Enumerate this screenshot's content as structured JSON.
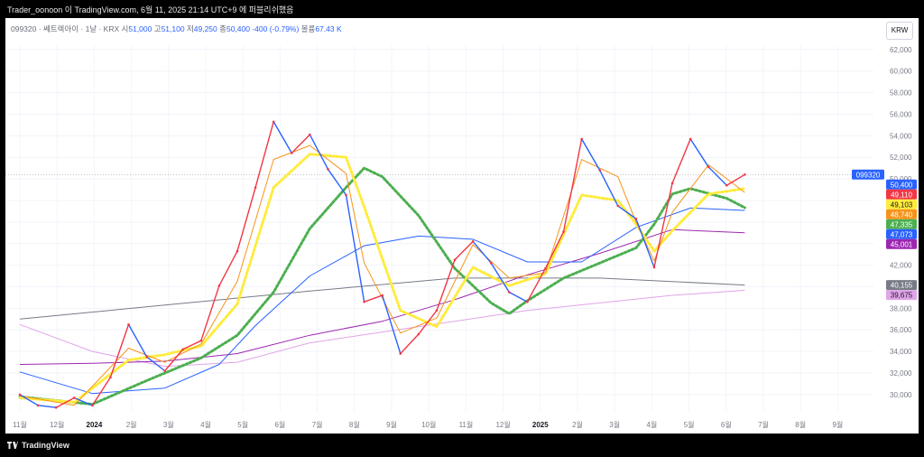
{
  "header": {
    "title": "Trader_oonoon 이 TradingView.com, 6월 11, 2025 21:14 UTC+9 에 퍼블리쉬했음"
  },
  "legend": {
    "symbol": "099320 · 쎄트렉아이 · 1날 · KRX",
    "open_label": "시",
    "open": "51,000",
    "high_label": "고",
    "high": "51,100",
    "low_label": "저",
    "low": "49,250",
    "close_label": "종",
    "close": "50,400",
    "change": "-400 (-0.79%)",
    "volume_label": "볼륨",
    "volume": "67.43 K"
  },
  "currency": "KRW",
  "footer": {
    "brand": "TradingView"
  },
  "colors": {
    "up": "#f23645",
    "down": "#2962ff",
    "ma_orange": "#f7931a",
    "ma_yellow": "#ffeb3b",
    "ma_green": "#4caf50",
    "ma_blue": "#2962ff",
    "ma_purple": "#9c27b0",
    "ma_gray": "#787b86",
    "ma_pink": "#e1a4e8"
  },
  "chart_data": {
    "type": "line",
    "y_ticks": [
      "30,000",
      "32,000",
      "34,000",
      "36,000",
      "38,000",
      "40,000",
      "42,000",
      "44,000",
      "46,000",
      "48,000",
      "50,000",
      "52,000",
      "54,000",
      "56,000",
      "58,000",
      "60,000",
      "62,000"
    ],
    "ylim": [
      28400,
      62400
    ],
    "x_ticks": [
      "11월",
      "12월",
      "2024",
      "2월",
      "3월",
      "4월",
      "5월",
      "6월",
      "7월",
      "8월",
      "9월",
      "10월",
      "11월",
      "12월",
      "2025",
      "2월",
      "3월",
      "4월",
      "5월",
      "6월",
      "7월",
      "8월",
      "9월"
    ],
    "price_series": {
      "name": "099320",
      "points": [
        [
          0,
          30000
        ],
        [
          1,
          29000
        ],
        [
          2,
          28800
        ],
        [
          3,
          29700
        ],
        [
          4,
          29000
        ],
        [
          5,
          31600
        ],
        [
          6,
          36500
        ],
        [
          7,
          33500
        ],
        [
          8,
          32200
        ],
        [
          9,
          34200
        ],
        [
          10,
          35000
        ],
        [
          11,
          40100
        ],
        [
          12,
          43300
        ],
        [
          13,
          49200
        ],
        [
          14,
          55300
        ],
        [
          15,
          52400
        ],
        [
          16,
          54100
        ],
        [
          17,
          50900
        ],
        [
          18,
          48500
        ],
        [
          19,
          38600
        ],
        [
          20,
          39200
        ],
        [
          21,
          33800
        ],
        [
          22,
          35600
        ],
        [
          23,
          37800
        ],
        [
          24,
          42500
        ],
        [
          25,
          44200
        ],
        [
          26,
          42200
        ],
        [
          27,
          39500
        ],
        [
          28,
          38600
        ],
        [
          29,
          41700
        ],
        [
          30,
          45100
        ],
        [
          31,
          53700
        ],
        [
          32,
          50800
        ],
        [
          33,
          47500
        ],
        [
          34,
          46300
        ],
        [
          35,
          41800
        ],
        [
          36,
          49600
        ],
        [
          37,
          53700
        ],
        [
          38,
          51100
        ],
        [
          39,
          49400
        ],
        [
          40,
          50400
        ]
      ]
    },
    "last_price": "50,400",
    "price_labels": [
      {
        "text": "099320",
        "value": 50400,
        "color": "#2962ff",
        "kind": "symbol"
      },
      {
        "text": "50,400",
        "value": 50400,
        "color": "#2962ff"
      },
      {
        "text": "49,110",
        "value": 49110,
        "color": "#f23645"
      },
      {
        "text": "49,103",
        "value": 49103,
        "color": "#ffeb3b"
      },
      {
        "text": "48,740",
        "value": 48740,
        "color": "#f7931a"
      },
      {
        "text": "47,335",
        "value": 47335,
        "color": "#4caf50"
      },
      {
        "text": "47,073",
        "value": 47073,
        "color": "#2962ff"
      },
      {
        "text": "45,001",
        "value": 45001,
        "color": "#9c27b0"
      },
      {
        "text": "40,155",
        "value": 40155,
        "color": "#787b86"
      },
      {
        "text": "39,675",
        "value": 39675,
        "color": "#e1a4e8"
      }
    ],
    "moving_averages": [
      {
        "color": "#787b86",
        "points": [
          [
            0,
            37000
          ],
          [
            8,
            38300
          ],
          [
            16,
            39600
          ],
          [
            24,
            40800
          ],
          [
            32,
            40800
          ],
          [
            40,
            40155
          ]
        ]
      },
      {
        "color": "#e1a4e8",
        "points": [
          [
            0,
            36500
          ],
          [
            4,
            34000
          ],
          [
            8,
            32600
          ],
          [
            12,
            33000
          ],
          [
            16,
            34800
          ],
          [
            20,
            35800
          ],
          [
            24,
            36800
          ],
          [
            28,
            37800
          ],
          [
            32,
            38500
          ],
          [
            36,
            39200
          ],
          [
            40,
            39675
          ]
        ]
      },
      {
        "color": "#9c27b0",
        "points": [
          [
            0,
            32800
          ],
          [
            4,
            32900
          ],
          [
            8,
            33100
          ],
          [
            12,
            33800
          ],
          [
            16,
            35500
          ],
          [
            20,
            36800
          ],
          [
            24,
            38800
          ],
          [
            28,
            41100
          ],
          [
            32,
            43100
          ],
          [
            36,
            45300
          ],
          [
            40,
            45001
          ]
        ]
      },
      {
        "color": "#2962ff",
        "points": [
          [
            0,
            32100
          ],
          [
            4,
            30100
          ],
          [
            8,
            30600
          ],
          [
            11,
            32800
          ],
          [
            13,
            36400
          ],
          [
            16,
            41000
          ],
          [
            19,
            43800
          ],
          [
            22,
            44700
          ],
          [
            25,
            44400
          ],
          [
            28,
            42300
          ],
          [
            31,
            42300
          ],
          [
            34,
            45500
          ],
          [
            37,
            47300
          ],
          [
            40,
            47073
          ]
        ]
      },
      {
        "color": "#4caf50",
        "dotted": true,
        "points": [
          [
            0,
            29800
          ],
          [
            4,
            29100
          ],
          [
            7,
            31300
          ],
          [
            10,
            33400
          ],
          [
            12,
            35500
          ],
          [
            14,
            39500
          ],
          [
            16,
            45400
          ],
          [
            18,
            49200
          ],
          [
            19,
            51000
          ],
          [
            20,
            50200
          ],
          [
            22,
            46600
          ],
          [
            24,
            41700
          ],
          [
            26,
            38500
          ],
          [
            27,
            37500
          ],
          [
            28,
            38700
          ],
          [
            30,
            40800
          ],
          [
            32,
            42200
          ],
          [
            34,
            43600
          ],
          [
            35,
            45800
          ],
          [
            36,
            48600
          ],
          [
            37,
            49100
          ],
          [
            39,
            48200
          ],
          [
            40,
            47335
          ]
        ]
      },
      {
        "color": "#ffeb3b",
        "dotted": true,
        "points": [
          [
            0,
            29700
          ],
          [
            3,
            29300
          ],
          [
            6,
            33200
          ],
          [
            8,
            33700
          ],
          [
            10,
            34500
          ],
          [
            12,
            38400
          ],
          [
            14,
            49200
          ],
          [
            16,
            52300
          ],
          [
            18,
            52000
          ],
          [
            19,
            47400
          ],
          [
            21,
            37800
          ],
          [
            23,
            36300
          ],
          [
            25,
            41800
          ],
          [
            27,
            40100
          ],
          [
            29,
            41200
          ],
          [
            31,
            48500
          ],
          [
            33,
            48000
          ],
          [
            34,
            45800
          ],
          [
            35,
            43300
          ],
          [
            36,
            45200
          ],
          [
            38,
            48600
          ],
          [
            40,
            49103
          ]
        ]
      },
      {
        "color": "#f7931a",
        "points": [
          [
            0,
            29900
          ],
          [
            3,
            29000
          ],
          [
            6,
            34300
          ],
          [
            8,
            33000
          ],
          [
            10,
            34700
          ],
          [
            12,
            40500
          ],
          [
            14,
            51800
          ],
          [
            16,
            53100
          ],
          [
            18,
            50500
          ],
          [
            19,
            42200
          ],
          [
            21,
            35700
          ],
          [
            23,
            37100
          ],
          [
            25,
            43900
          ],
          [
            27,
            40800
          ],
          [
            29,
            41300
          ],
          [
            31,
            51800
          ],
          [
            33,
            50200
          ],
          [
            34,
            46000
          ],
          [
            35,
            42400
          ],
          [
            36,
            46900
          ],
          [
            38,
            51300
          ],
          [
            40,
            48740
          ]
        ]
      }
    ]
  }
}
